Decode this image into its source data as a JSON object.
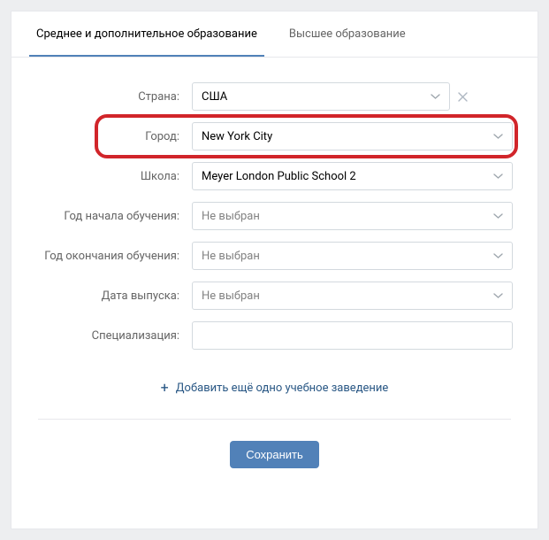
{
  "tabs": {
    "secondary": "Среднее и дополнительное образование",
    "higher": "Высшее образование"
  },
  "labels": {
    "country": "Страна:",
    "city": "Город:",
    "school": "Школа:",
    "startYear": "Год начала обучения:",
    "endYear": "Год окончания обучения:",
    "graduation": "Дата выпуска:",
    "specialization": "Специализация:"
  },
  "values": {
    "country": "США",
    "city": "New York City",
    "school": "Meyer London Public School 2",
    "startYear": "Не выбран",
    "endYear": "Не выбран",
    "graduation": "Не выбран",
    "specialization": ""
  },
  "actions": {
    "addMore": "Добавить ещё одно учебное заведение",
    "save": "Сохранить"
  }
}
